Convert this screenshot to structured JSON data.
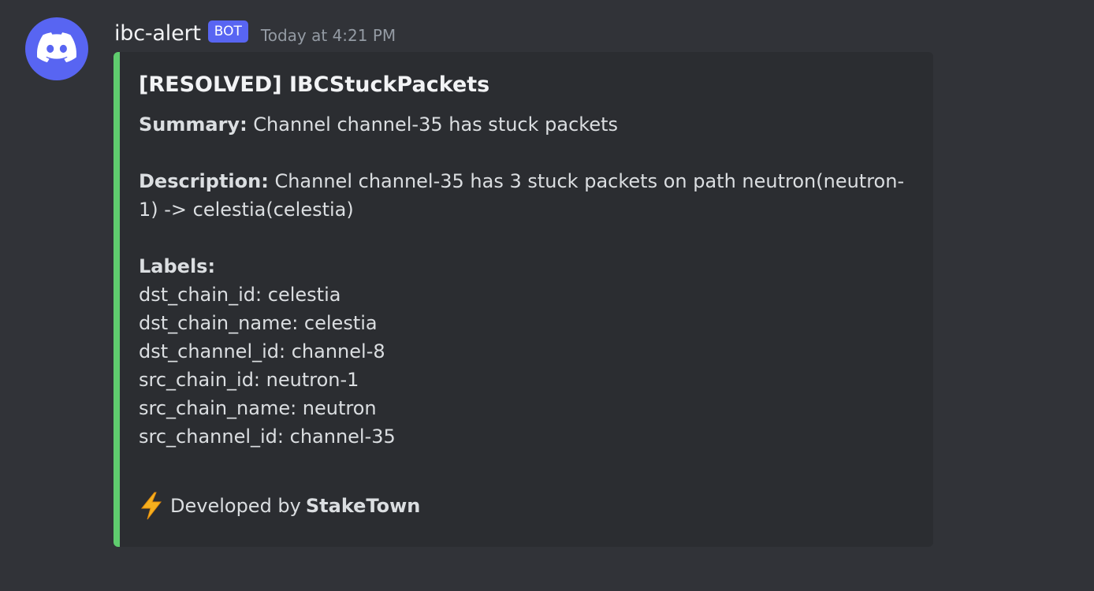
{
  "message": {
    "author": "ibc-alert",
    "badge": "BOT",
    "timestamp": "Today at 4:21 PM",
    "avatar_icon": "discord-logo-icon",
    "colors": {
      "background": "#313338",
      "embed_background": "#2b2d31",
      "embed_accent": "#5fcc6e",
      "badge": "#5865f2"
    }
  },
  "embed": {
    "title": "[RESOLVED] IBCStuckPackets",
    "summary_label": "Summary:",
    "summary_text": " Channel channel-35 has stuck packets",
    "description_label": "Description:",
    "description_text": " Channel channel-35 has 3 stuck packets on path neutron(neutron-1) -> celestia(celestia)",
    "labels_heading": "Labels:",
    "labels": [
      "dst_chain_id: celestia",
      "dst_chain_name: celestia",
      "dst_channel_id: channel-8",
      "src_chain_id: neutron-1",
      "src_chain_name: neutron",
      "src_channel_id: channel-35"
    ],
    "footer_icon": "lightning-bolt-icon",
    "footer_prefix": "Developed by",
    "footer_brand": "StakeTown"
  }
}
